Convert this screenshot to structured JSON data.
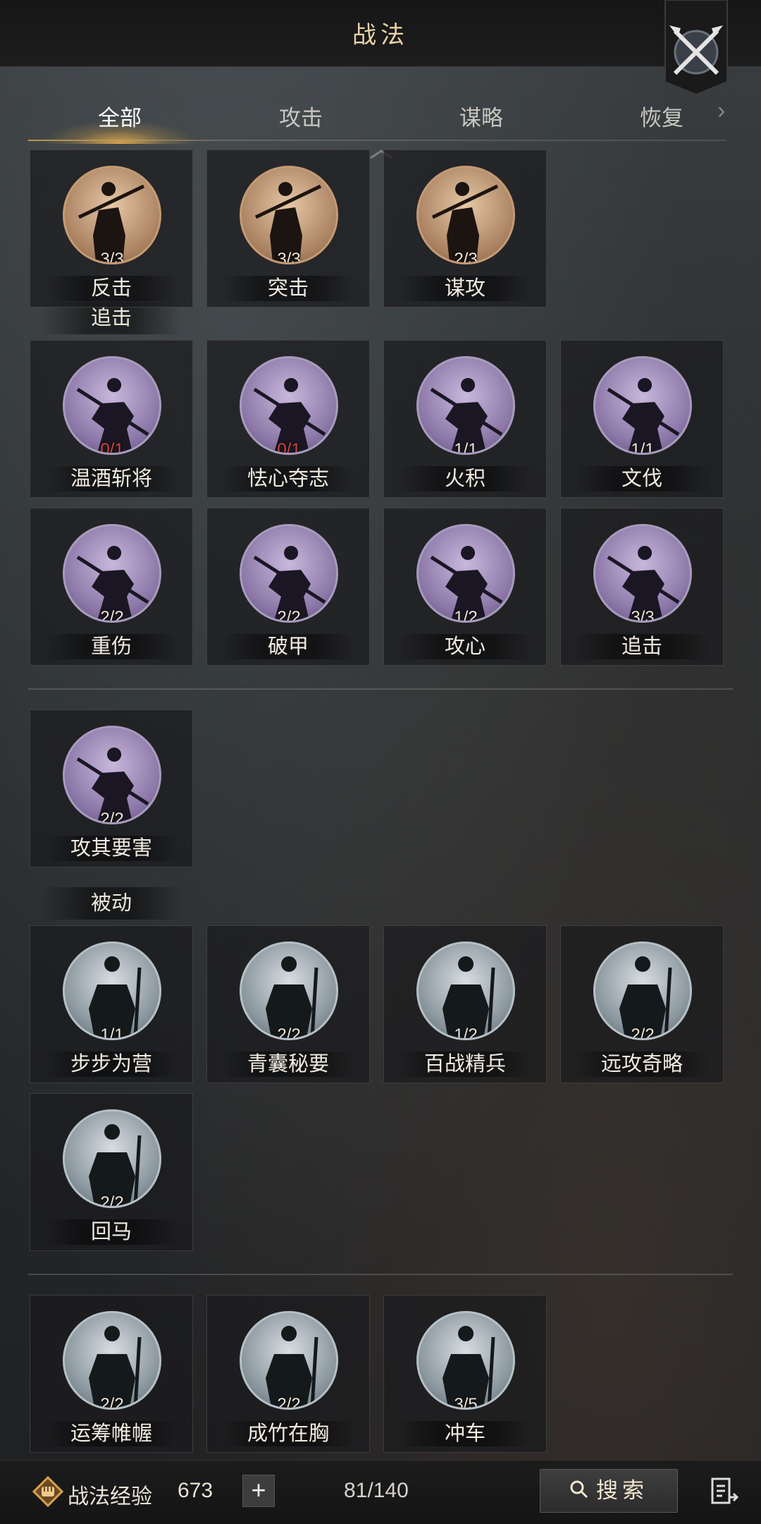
{
  "header": {
    "title": "战法"
  },
  "tabs": [
    {
      "label": "全部",
      "active": true
    },
    {
      "label": "攻击",
      "active": false
    },
    {
      "label": "谋略",
      "active": false
    },
    {
      "label": "恢复",
      "active": false
    }
  ],
  "sections": [
    {
      "label": "追击"
    },
    {
      "label": "被动"
    }
  ],
  "cards": [
    {
      "name": "反击",
      "count": "3/3",
      "style": "bronze"
    },
    {
      "name": "突击",
      "count": "3/3",
      "style": "bronze"
    },
    {
      "name": "谋攻",
      "count": "2/3",
      "style": "bronze"
    },
    {
      "name": "温酒斩将",
      "count": "0/1",
      "style": "purple"
    },
    {
      "name": "怯心夺志",
      "count": "0/1",
      "style": "purple"
    },
    {
      "name": "火积",
      "count": "1/1",
      "style": "purple"
    },
    {
      "name": "文伐",
      "count": "1/1",
      "style": "purple"
    },
    {
      "name": "重伤",
      "count": "2/2",
      "style": "purple"
    },
    {
      "name": "破甲",
      "count": "2/2",
      "style": "purple"
    },
    {
      "name": "攻心",
      "count": "1/2",
      "style": "purple"
    },
    {
      "name": "追击",
      "count": "3/3",
      "style": "purple"
    },
    {
      "name": "攻其要害",
      "count": "2/2",
      "style": "purple"
    },
    {
      "name": "步步为营",
      "count": "1/1",
      "style": "steel"
    },
    {
      "name": "青囊秘要",
      "count": "2/2",
      "style": "steel"
    },
    {
      "name": "百战精兵",
      "count": "1/2",
      "style": "steel"
    },
    {
      "name": "远攻奇略",
      "count": "2/2",
      "style": "steel"
    },
    {
      "name": "回马",
      "count": "2/2",
      "style": "steel"
    },
    {
      "name": "运筹帷幄",
      "count": "2/2",
      "style": "steel"
    },
    {
      "name": "成竹在胸",
      "count": "2/2",
      "style": "steel"
    },
    {
      "name": "冲车",
      "count": "3/5",
      "style": "steel"
    }
  ],
  "footer": {
    "xp_label": "战法经验",
    "xp_value": "673",
    "plus": "+",
    "capacity": "81/140",
    "search_label": "搜索"
  },
  "icons": [
    "crossed-swords-icon",
    "chevron-right-icon",
    "scroll-up-icon",
    "xp-fist-icon",
    "search-icon",
    "exit-icon"
  ],
  "colors": {
    "accent": "#e9b04c",
    "count_empty": "#d2463c"
  }
}
